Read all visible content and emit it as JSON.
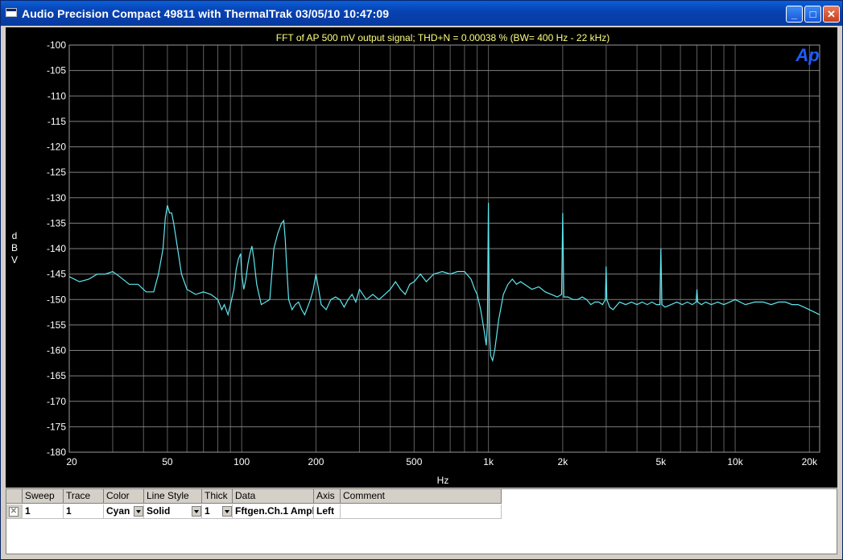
{
  "window": {
    "title": "Audio Precision  Compact 49811 with ThermalTrak  03/05/10 10:47:09",
    "buttons": [
      "_",
      "□",
      "✕"
    ]
  },
  "graph": {
    "logo": "Ap",
    "colors": {
      "background": "#000000",
      "grid": "#7f7f7f",
      "trace": "#5fe6ee",
      "title": "#ffff80",
      "axis_text": "#ffffff"
    }
  },
  "chart_data": {
    "type": "line",
    "title": "FFT of AP 500 mV output signal; THD+N = 0.00038 % (BW= 400 Hz - 22 kHz)",
    "xlabel": "Hz",
    "ylabel": "d\nB\nV",
    "x_scale": "log",
    "xlim": [
      20,
      22000
    ],
    "ylim": [
      -180,
      -100
    ],
    "x_tick_values": [
      20,
      50,
      100,
      200,
      500,
      1000,
      2000,
      5000,
      10000,
      20000
    ],
    "x_tick_labels": [
      "20",
      "50",
      "100",
      "200",
      "500",
      "1k",
      "2k",
      "5k",
      "10k",
      "20k"
    ],
    "y_tick_values": [
      -100,
      -105,
      -110,
      -115,
      -120,
      -125,
      -130,
      -135,
      -140,
      -145,
      -150,
      -155,
      -160,
      -165,
      -170,
      -175,
      -180
    ],
    "y_tick_labels": [
      "-100",
      "-105",
      "-110",
      "-115",
      "-120",
      "-125",
      "-130",
      "-135",
      "-140",
      "-145",
      "-150",
      "-155",
      "-160",
      "-165",
      "-170",
      "-175",
      "-180"
    ],
    "grid": true,
    "series": [
      {
        "color": "#5fe6ee",
        "x": [
          20,
          22,
          24,
          26,
          28,
          30,
          32,
          35,
          38,
          41,
          44,
          46,
          48,
          49,
          50,
          51,
          52,
          53,
          55,
          57,
          60,
          65,
          70,
          75,
          80,
          83,
          85,
          88,
          90,
          93,
          95,
          97,
          99,
          100,
          102,
          104,
          106,
          108,
          110,
          112,
          115,
          120,
          125,
          130,
          135,
          140,
          145,
          148,
          150,
          152,
          155,
          160,
          165,
          170,
          175,
          180,
          185,
          190,
          195,
          200,
          205,
          210,
          220,
          230,
          240,
          250,
          260,
          270,
          280,
          290,
          300,
          320,
          340,
          360,
          380,
          400,
          420,
          440,
          460,
          480,
          500,
          530,
          560,
          600,
          650,
          700,
          750,
          800,
          850,
          880,
          900,
          930,
          960,
          980,
          990,
          1000,
          1010,
          1020,
          1040,
          1060,
          1080,
          1100,
          1120,
          1150,
          1200,
          1250,
          1300,
          1350,
          1400,
          1500,
          1600,
          1700,
          1800,
          1900,
          1980,
          2000,
          2020,
          2100,
          2200,
          2300,
          2400,
          2500,
          2600,
          2700,
          2800,
          2900,
          2980,
          3000,
          3020,
          3100,
          3200,
          3400,
          3600,
          3800,
          4000,
          4200,
          4400,
          4600,
          4800,
          4950,
          5000,
          5050,
          5200,
          5500,
          5800,
          6100,
          6400,
          6700,
          6950,
          7000,
          7050,
          7300,
          7600,
          8000,
          8500,
          9000,
          9500,
          10000,
          11000,
          12000,
          13000,
          14000,
          15000,
          16000,
          17000,
          18000,
          19000,
          20000,
          21000,
          22000
        ],
        "y": [
          -145.5,
          -146.5,
          -146,
          -145,
          -145,
          -144.5,
          -145.5,
          -147,
          -147,
          -148.5,
          -148.5,
          -145,
          -140,
          -134,
          -131.5,
          -133,
          -133,
          -135,
          -140,
          -145,
          -148,
          -149,
          -148.5,
          -149,
          -150,
          -152,
          -151,
          -153,
          -151,
          -148,
          -144,
          -142,
          -141,
          -145,
          -148,
          -146,
          -143,
          -141,
          -139.5,
          -142,
          -147,
          -151,
          -150.5,
          -150,
          -140,
          -137,
          -135,
          -134.5,
          -138,
          -143,
          -150,
          -152,
          -151,
          -150.5,
          -152,
          -153,
          -151.5,
          -150,
          -148,
          -145,
          -148,
          -151,
          -152,
          -150,
          -149.5,
          -150,
          -151.5,
          -150,
          -149,
          -150.5,
          -148,
          -150,
          -149,
          -150,
          -149,
          -148,
          -146.5,
          -148,
          -149,
          -147,
          -146.5,
          -145,
          -146.5,
          -145,
          -144.5,
          -145,
          -144.5,
          -144.5,
          -146,
          -148,
          -149,
          -152,
          -156,
          -159,
          -155,
          -131,
          -157,
          -161,
          -162,
          -160,
          -157,
          -154,
          -152,
          -149,
          -147,
          -146,
          -147,
          -146.5,
          -147,
          -148,
          -147.5,
          -148.5,
          -149,
          -149.5,
          -149,
          -133,
          -149.5,
          -149.5,
          -150,
          -150,
          -149.5,
          -150,
          -151,
          -150.5,
          -150.5,
          -151,
          -150,
          -143.5,
          -150,
          -151.5,
          -152,
          -150.5,
          -151,
          -150.5,
          -151,
          -150.5,
          -151,
          -150.5,
          -151,
          -151,
          -140,
          -151,
          -151.5,
          -151,
          -150.5,
          -151,
          -150.5,
          -151,
          -150.5,
          -148,
          -150.5,
          -151,
          -150.5,
          -151,
          -150.5,
          -151,
          -150.5,
          -150,
          -151,
          -150.5,
          -150.5,
          -151,
          -150.5,
          -150.5,
          -151,
          -151,
          -151.5,
          -152,
          -152.5,
          -153
        ]
      }
    ]
  },
  "table": {
    "headers": [
      "Sweep",
      "Trace",
      "Color",
      "Line Style",
      "Thick",
      "Data",
      "Axis",
      "Comment"
    ],
    "rows": [
      {
        "check": "✕",
        "sweep": "1",
        "trace": "1",
        "color": "Cyan",
        "line_style": "Solid",
        "thick": "1",
        "data": "Fftgen.Ch.1 Ampl",
        "axis": "Left",
        "comment": ""
      }
    ]
  }
}
